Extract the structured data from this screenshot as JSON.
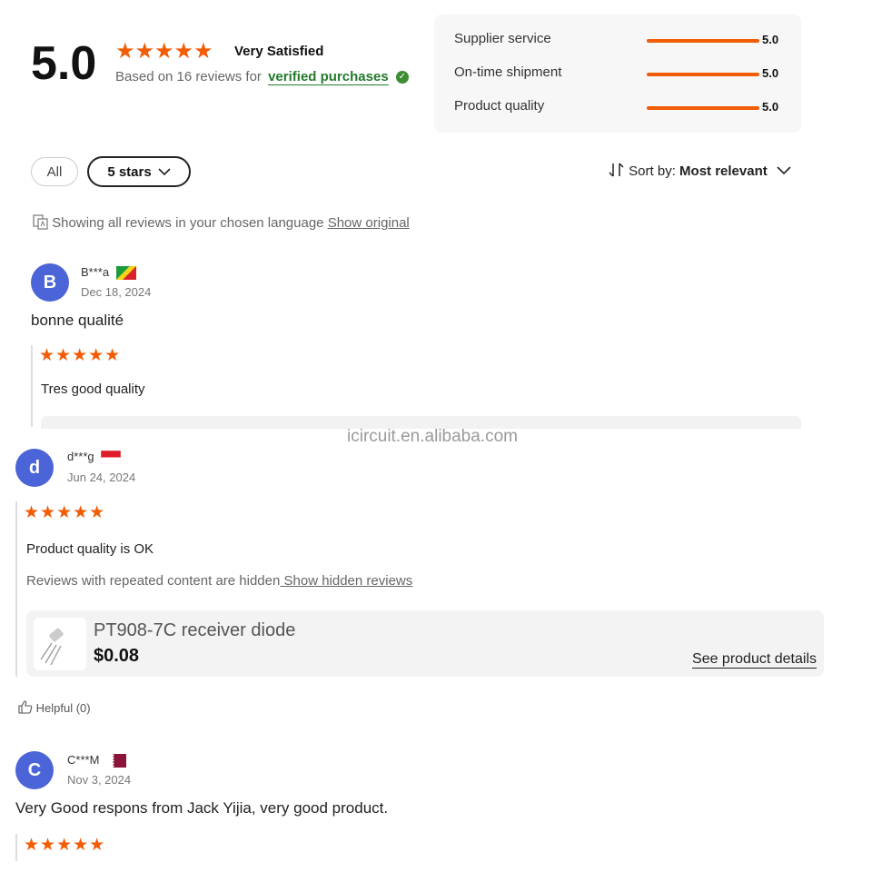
{
  "summary": {
    "score": "5.0",
    "stars": "★★★★★",
    "label": "Very Satisfied",
    "based_on": "Based on 16 reviews for",
    "verified": "verified purchases"
  },
  "ratings": [
    {
      "label": "Supplier service",
      "value": "5.0"
    },
    {
      "label": "On-time shipment",
      "value": "5.0"
    },
    {
      "label": "Product quality",
      "value": "5.0"
    }
  ],
  "filters": {
    "all": "All",
    "five_stars": "5 stars",
    "sort_prefix": "Sort by:",
    "sort_value": "Most relevant"
  },
  "language_notice": {
    "text": "Showing all reviews in your chosen language",
    "link": "Show original"
  },
  "watermark": "icircuit.en.alibaba.com",
  "reviews": [
    {
      "initial": "B",
      "user": "B***a",
      "date": "Dec 18, 2024",
      "text": "bonne qualité",
      "stars": "★★★★★",
      "comment": "Tres good quality"
    },
    {
      "initial": "d",
      "user": "d***g",
      "date": "Jun 24, 2024",
      "stars": "★★★★★",
      "comment": "Product quality is OK",
      "hidden_notice": "Reviews with repeated content are hidden",
      "hidden_link": " Show hidden reviews",
      "product_name": "PT908-7C receiver diode",
      "product_price": "$0.08",
      "product_link": "See product details",
      "helpful": "Helpful (0)"
    },
    {
      "initial": "C",
      "user": "C***M",
      "date": "Nov 3, 2024",
      "text": "Very Good respons from Jack Yijia, very good product.",
      "stars": "★★★★★"
    }
  ],
  "colors": {
    "accent_orange": "#f25c05",
    "verified_green": "#237a2d",
    "avatar_blue": "#4b64d8"
  }
}
